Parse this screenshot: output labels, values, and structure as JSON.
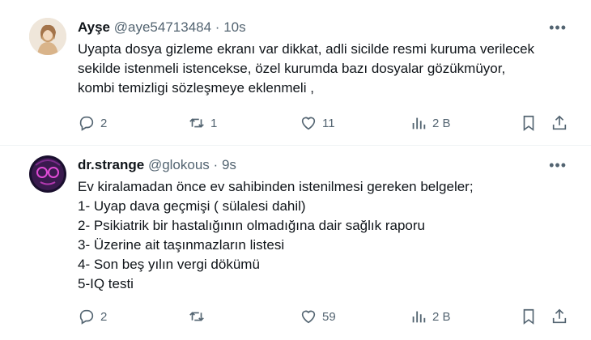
{
  "tweets": [
    {
      "name": "Ayşe",
      "handle": "@aye54713484",
      "separator": "·",
      "time": "10s",
      "more": "•••",
      "lines": [
        "Uyapta dosya gizleme ekranı var  dikkat, adli sicilde resmi kuruma verilecek",
        "sekilde istenmeli istencekse, özel kurumda bazı dosyalar gözükmüyor,",
        "kombi temizligi sözleşmeye eklenmeli ,"
      ],
      "replies": "2",
      "reposts": "1",
      "likes": "11",
      "views": "2 B"
    },
    {
      "name": "dr.strange",
      "handle": "@glokous",
      "separator": "·",
      "time": "9s",
      "more": "•••",
      "lines": [
        "Ev kiralamadan önce ev sahibinden istenilmesi gereken belgeler;",
        "1- Uyap dava geçmişi ( sülalesi dahil)",
        "2- Psikiatrik bir hastalığının olmadığına dair sağlık  raporu",
        "3- Üzerine ait taşınmazların listesi",
        "4- Son beş yılın vergi dökümü",
        "5-IQ testi"
      ],
      "replies": "2",
      "reposts": "",
      "likes": "59",
      "views": "2 B"
    }
  ],
  "icons": {
    "reply": "reply-icon",
    "repost": "repost-icon",
    "like": "heart-icon",
    "views": "views-icon",
    "bookmark": "bookmark-icon",
    "share": "share-icon"
  },
  "colors": {
    "text": "#0f1419",
    "secondary": "#536471",
    "border": "#eff3f4"
  }
}
